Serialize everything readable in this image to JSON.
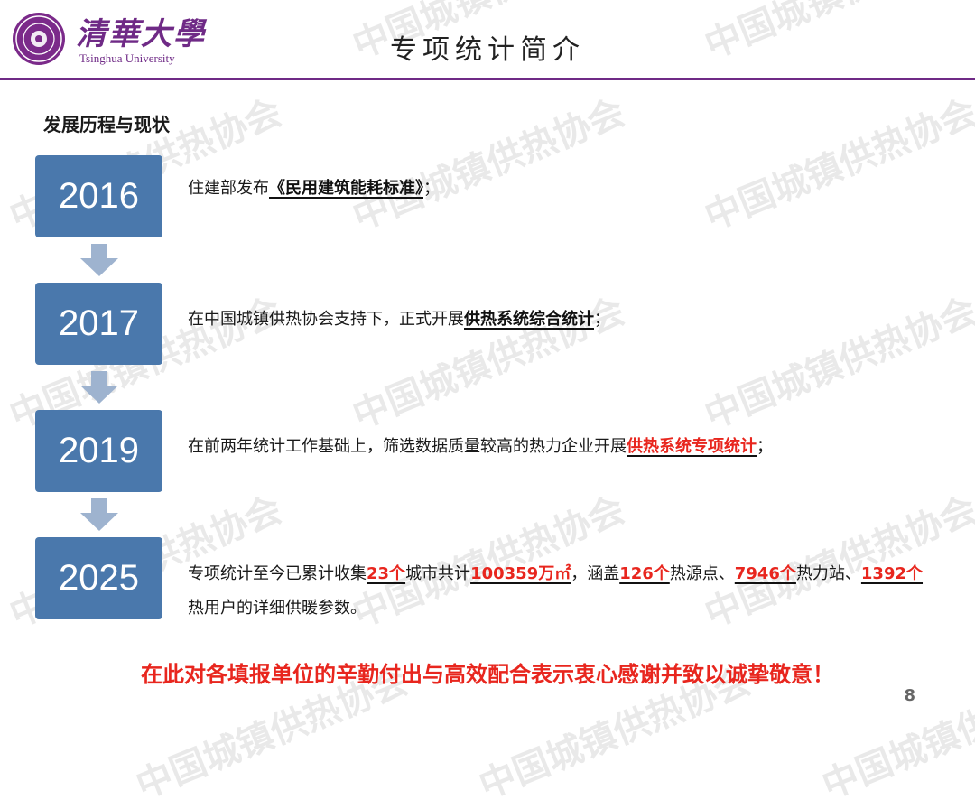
{
  "header": {
    "logo_cn": "清華大學",
    "logo_en": "Tsinghua University",
    "title": "专项统计简介"
  },
  "watermark": {
    "text": "中国城镇供热协会"
  },
  "section": {
    "heading": "发展历程与现状"
  },
  "timeline": [
    {
      "year": "2016",
      "lines": [
        {
          "t": "住建部发布"
        },
        {
          "t": "《民用建筑能耗标准》",
          "s": "b"
        },
        {
          "t": "；"
        }
      ]
    },
    {
      "year": "2017",
      "lines": [
        {
          "t": "在中国城镇供热协会支持下，正式开展"
        },
        {
          "t": "供热系统综合统计",
          "s": "b"
        },
        {
          "t": "；"
        }
      ]
    },
    {
      "year": "2019",
      "lines": [
        {
          "t": "在前两年统计工作基础上，筛选数据质量较高的热力企业开展"
        },
        {
          "t": "供热系统专项统计",
          "s": "r"
        },
        {
          "t": "；"
        }
      ]
    },
    {
      "year": "2025",
      "lines": [
        {
          "t": "专项统计至今已累计收集"
        },
        {
          "t": "23个",
          "s": "r"
        },
        {
          "t": "城市共计"
        },
        {
          "t": "100359万㎡",
          "s": "r"
        },
        {
          "t": "，涵盖"
        },
        {
          "t": "126个",
          "s": "r"
        },
        {
          "t": "热源点、"
        },
        {
          "t": "7946个",
          "s": "r"
        },
        {
          "t": "热力站、"
        },
        {
          "t": "1392个",
          "s": "r"
        },
        {
          "t": "热用户的详细供暖参数。"
        }
      ]
    }
  ],
  "thanks": "在此对各填报单位的辛勤付出与高效配合表示衷心感谢并致以诚挚敬意！",
  "page_number": "8",
  "colors": {
    "purple": "#6f2a86",
    "year_box": "#4a78ac",
    "arrow": "#9eb3cf",
    "red": "#e8261e"
  }
}
